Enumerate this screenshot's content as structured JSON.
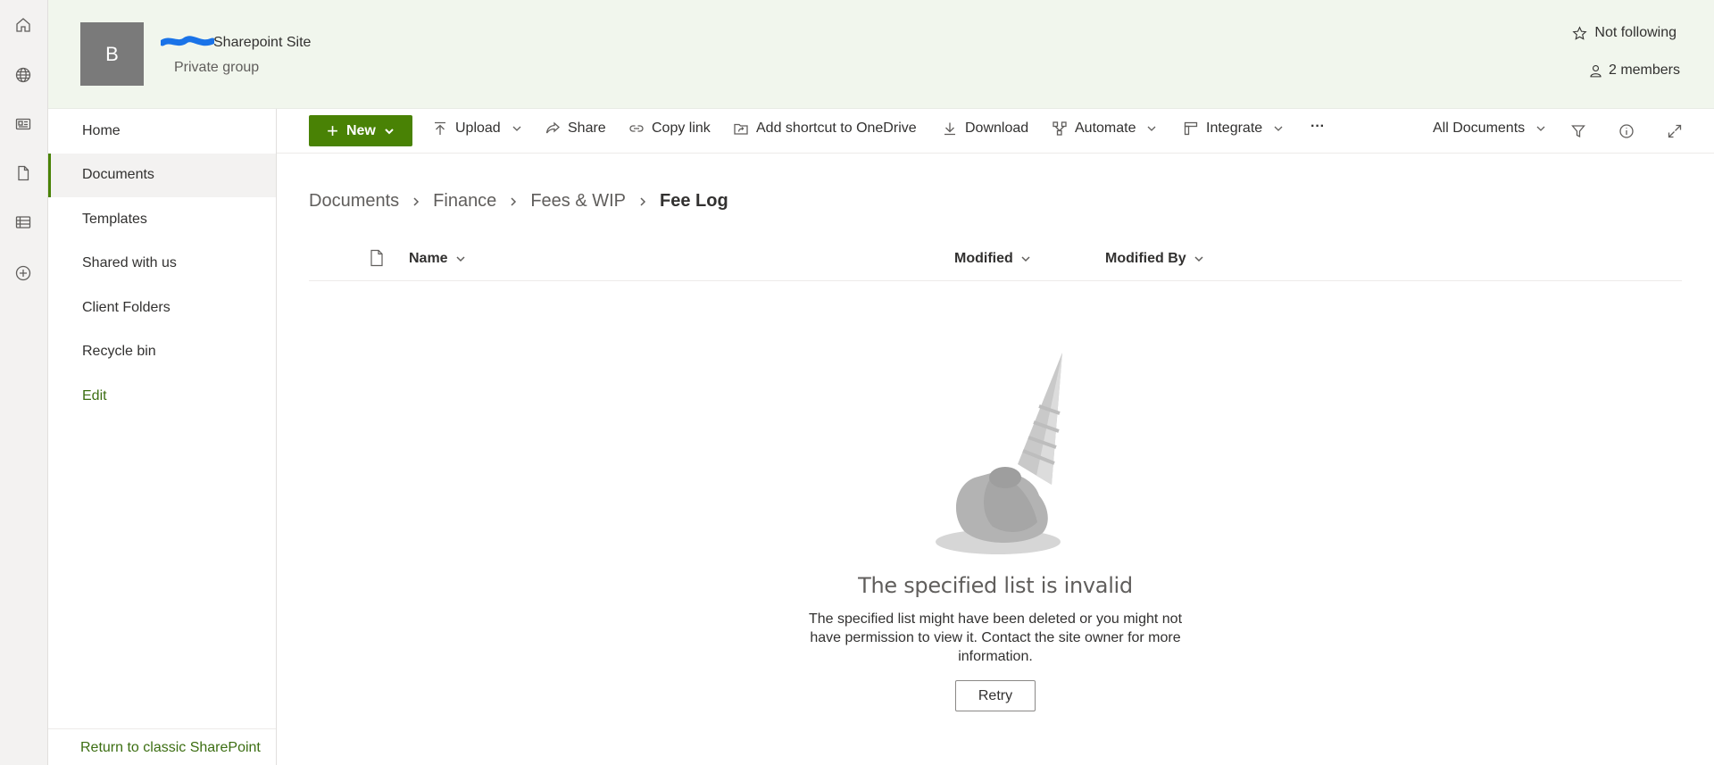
{
  "appbar": {
    "icons": [
      "home-icon",
      "globe-icon",
      "news-icon",
      "files-icon",
      "lists-icon",
      "create-icon"
    ]
  },
  "header": {
    "logo_letter": "B",
    "site_title": "Sharepoint Site",
    "site_subtitle": "Private group",
    "follow_label": "Not following",
    "members_label": "2 members"
  },
  "nav": {
    "items": [
      {
        "label": "Home"
      },
      {
        "label": "Documents"
      },
      {
        "label": "Templates"
      },
      {
        "label": "Shared with us"
      },
      {
        "label": "Client Folders"
      },
      {
        "label": "Recycle bin"
      },
      {
        "label": "Edit"
      }
    ],
    "classic_link": "Return to classic SharePoint"
  },
  "toolbar": {
    "new_label": "New",
    "upload_label": "Upload",
    "share_label": "Share",
    "copy_link_label": "Copy link",
    "shortcut_label": "Add shortcut to OneDrive",
    "download_label": "Download",
    "automate_label": "Automate",
    "integrate_label": "Integrate",
    "more_label": "···",
    "view_label": "All Documents"
  },
  "breadcrumb": {
    "items": [
      "Documents",
      "Finance",
      "Fees & WIP"
    ],
    "current": "Fee Log"
  },
  "columns": {
    "name": "Name",
    "modified": "Modified",
    "modified_by": "Modified By"
  },
  "empty_state": {
    "title": "The specified list is invalid",
    "description": "The specified list might have been deleted or you might not have permission to view it. Contact the site owner for more information.",
    "retry_label": "Retry"
  },
  "colors": {
    "accent": "#498205",
    "header_bg": "#f1f6ed",
    "link": "#3c6e12"
  }
}
